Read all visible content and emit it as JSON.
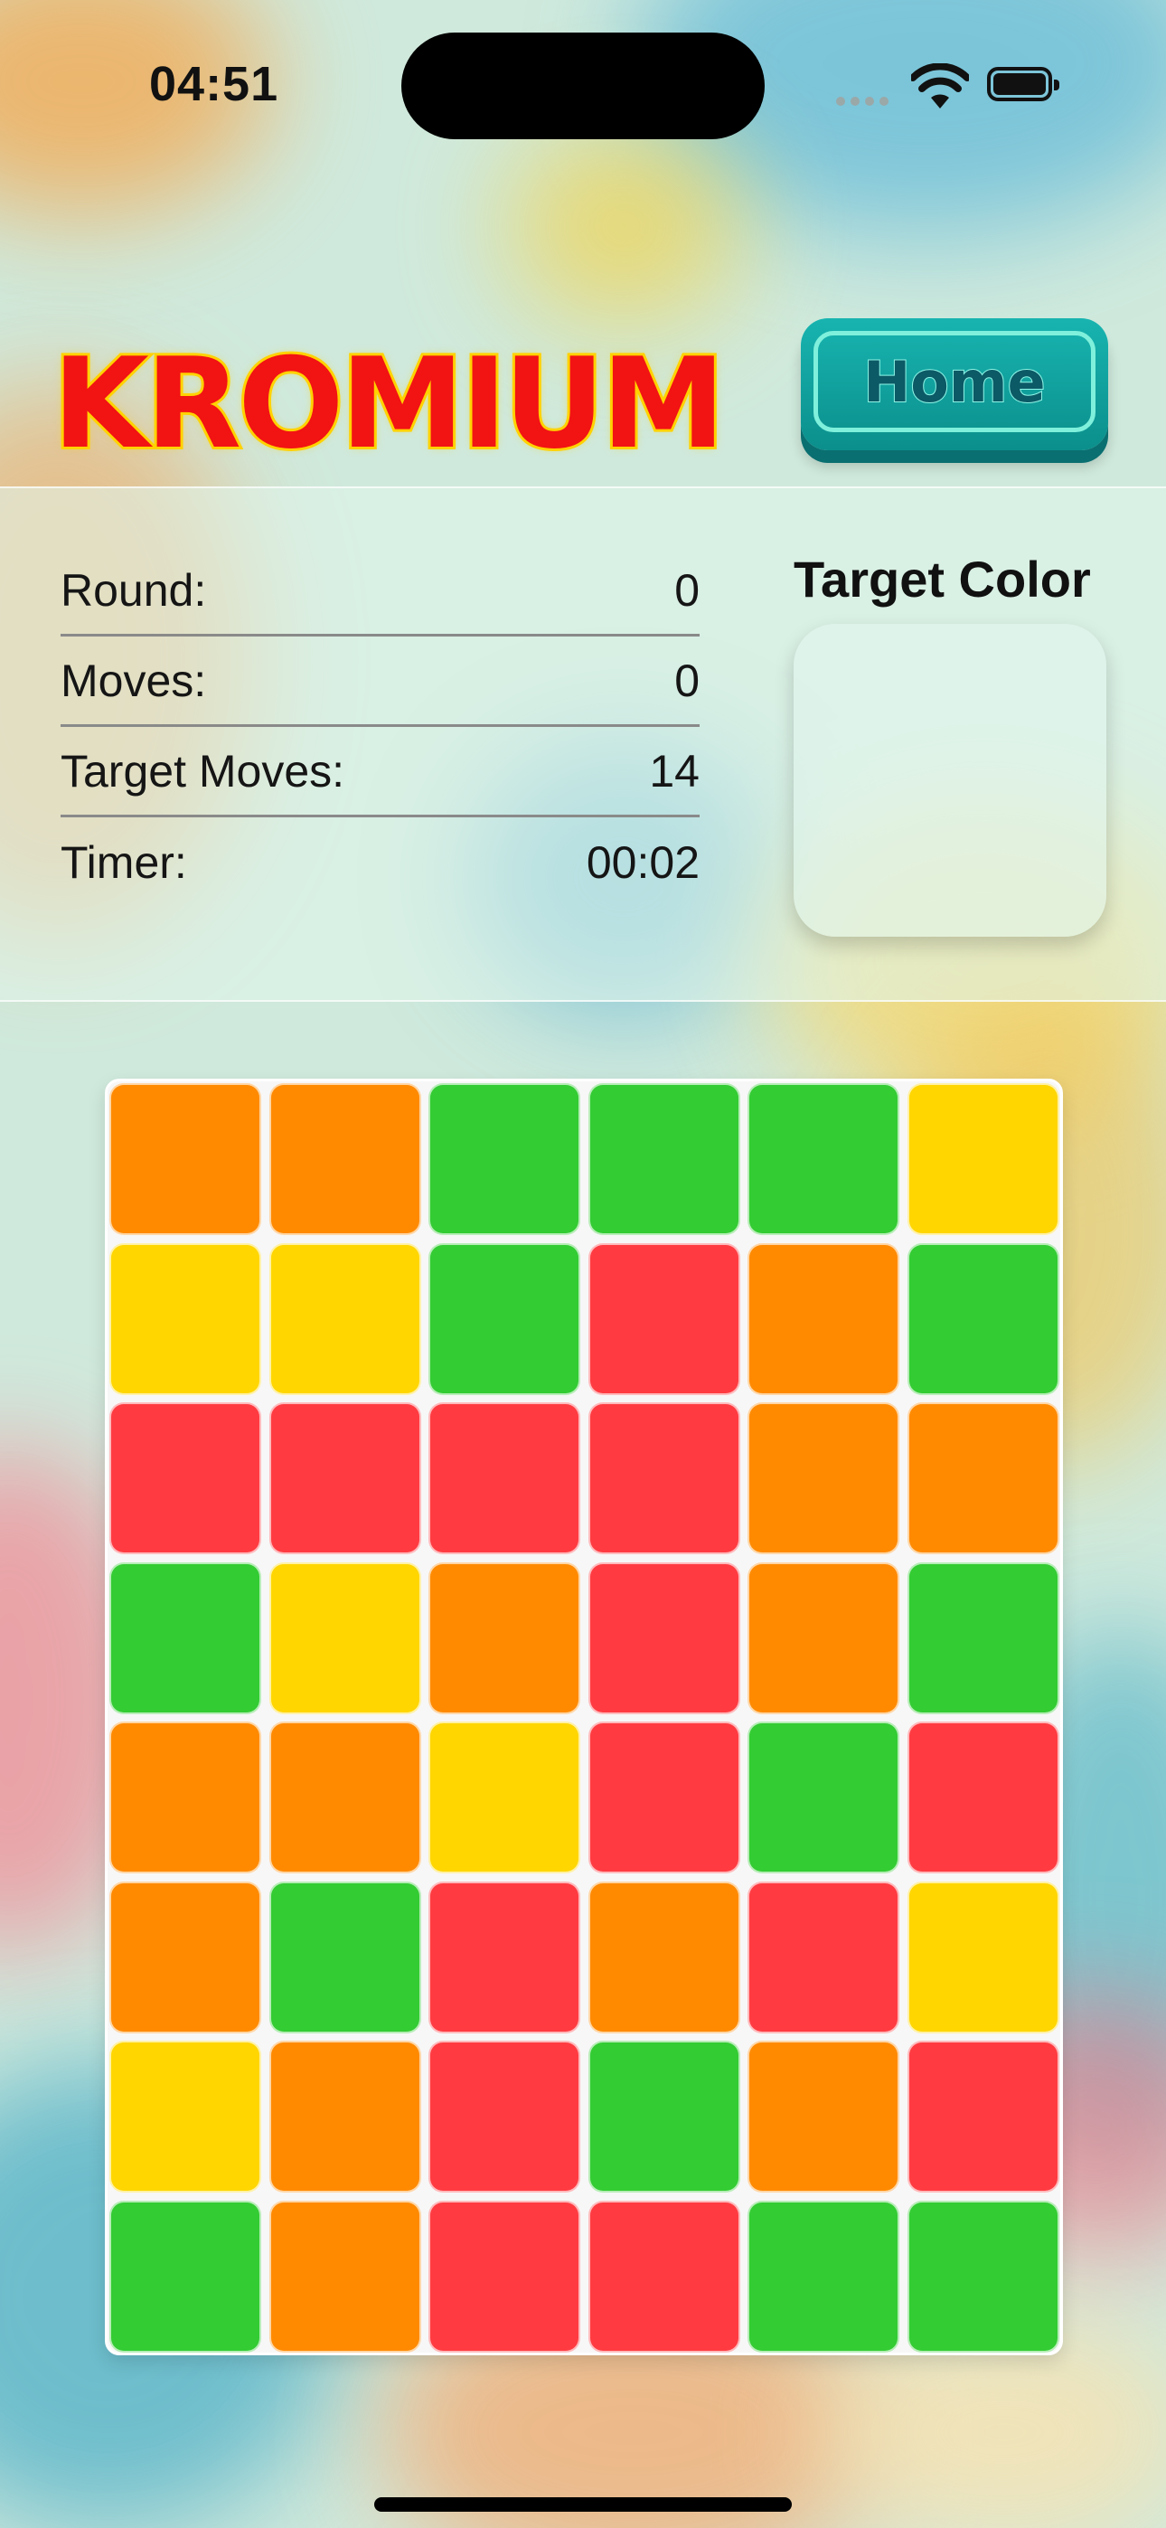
{
  "status_bar": {
    "time": "04:51"
  },
  "header": {
    "logo": "KROMIUM",
    "home_button_label": "Home"
  },
  "stats": [
    {
      "label": "Round:",
      "value": "0"
    },
    {
      "label": "Moves:",
      "value": "0"
    },
    {
      "label": "Target Moves:",
      "value": "14"
    },
    {
      "label": "Timer:",
      "value": "00:02"
    }
  ],
  "target": {
    "title": "Target Color"
  },
  "palette": {
    "O": "#ff8a00",
    "G": "#33cc33",
    "Y": "#ffd600",
    "R": "#ff3b41"
  },
  "board": {
    "rows": [
      [
        "O",
        "O",
        "G",
        "G",
        "G",
        "Y"
      ],
      [
        "Y",
        "Y",
        "G",
        "R",
        "O",
        "G"
      ],
      [
        "R",
        "R",
        "R",
        "R",
        "O",
        "O"
      ],
      [
        "G",
        "Y",
        "O",
        "R",
        "O",
        "G"
      ],
      [
        "O",
        "O",
        "Y",
        "R",
        "G",
        "R"
      ],
      [
        "O",
        "G",
        "R",
        "O",
        "R",
        "Y"
      ],
      [
        "Y",
        "O",
        "R",
        "G",
        "O",
        "R"
      ],
      [
        "G",
        "O",
        "R",
        "R",
        "G",
        "G"
      ]
    ]
  }
}
